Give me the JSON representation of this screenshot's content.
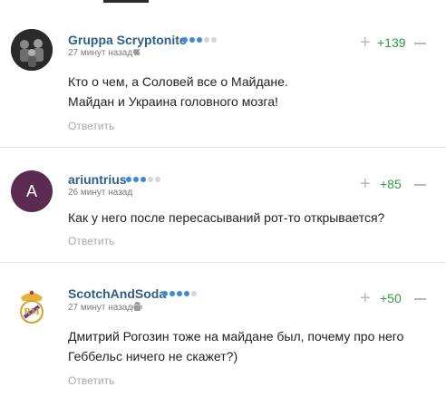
{
  "comments": [
    {
      "username": "Gruppa Scryptonite",
      "time": "27 минут назад",
      "text_lines": [
        "Кто о чем, а Соловей все о Майдане.",
        "Майдан и Украина головного мозга!"
      ],
      "reply_label": "Ответить",
      "score": "+139",
      "level_filled": 3,
      "level_total": 5,
      "device_icon": "apple-icon"
    },
    {
      "username": "ariuntrius",
      "avatar_letter": "A",
      "time": "26 минут назад",
      "text_lines": [
        "Как у него после пересасываний рот-то открывается?"
      ],
      "reply_label": "Ответить",
      "score": "+85",
      "level_filled": 3,
      "level_total": 5
    },
    {
      "username": "ScotchAndSoda",
      "time": "27 минут назад",
      "text_lines": [
        "Дмитрий Рогозин тоже на майдане был, почему про него",
        "Геббельс ничего не скажет?)"
      ],
      "reply_label": "Ответить",
      "score": "+50",
      "level_filled": 4,
      "level_total": 5,
      "device_icon": "android-icon"
    }
  ],
  "colors": {
    "username": "#2d5f8a",
    "dot_filled": "#3a8bd8",
    "dot_empty": "#d6d6d6",
    "score_positive": "#2e9c3e",
    "avatar_letter_bg": "#5b2b52"
  }
}
